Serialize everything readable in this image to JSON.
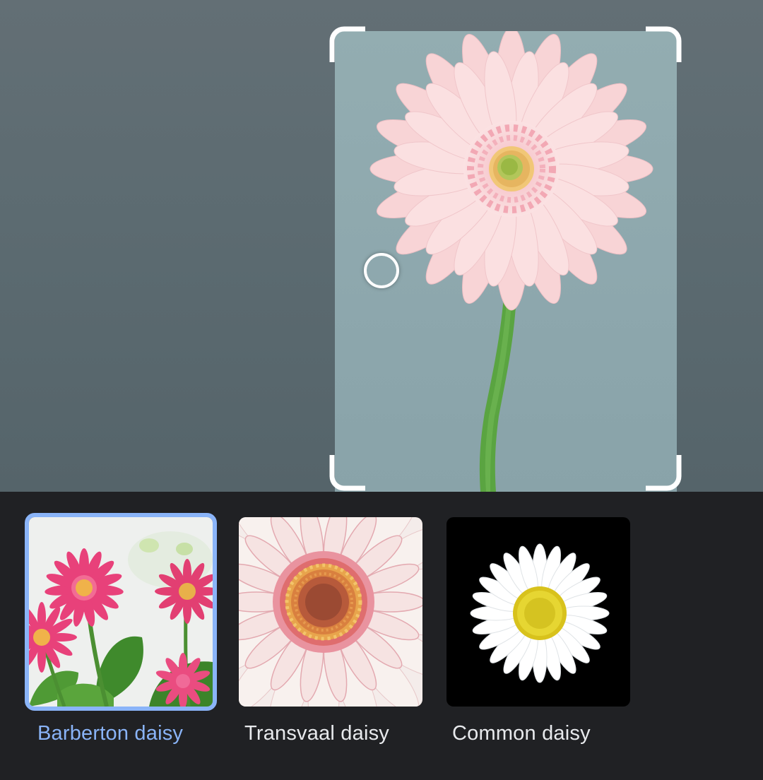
{
  "results": {
    "selected_index": 0,
    "items": [
      {
        "label": "Barberton daisy",
        "icon": "barberton-daisy-thumbnail"
      },
      {
        "label": "Transvaal daisy",
        "icon": "transvaal-daisy-thumbnail"
      },
      {
        "label": "Common daisy",
        "icon": "common-daisy-thumbnail"
      }
    ]
  },
  "colors": {
    "accent": "#8ab4f8",
    "sheet_background": "#202124",
    "label_text": "#e8eaed",
    "viewer_background": "#5e6b71",
    "photo_background": "#8fa9ae",
    "flower_pink": "#f6cdd0",
    "stem_green": "#58a33f"
  }
}
